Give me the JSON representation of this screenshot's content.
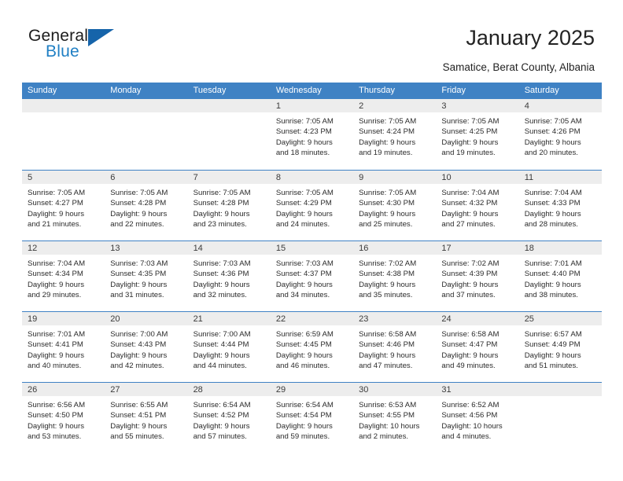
{
  "brand": {
    "name_part1": "General",
    "name_part2": "Blue",
    "logo_icon": "blue-triangle-logo"
  },
  "header": {
    "title": "January 2025",
    "subtitle": "Samatice, Berat County, Albania"
  },
  "colors": {
    "header_blue": "#3f82c4",
    "brand_blue": "#1f7fc4",
    "logo_blue": "#1664aa",
    "daynum_band": "#ededed",
    "text": "#2b2b2b"
  },
  "weekdays": [
    "Sunday",
    "Monday",
    "Tuesday",
    "Wednesday",
    "Thursday",
    "Friday",
    "Saturday"
  ],
  "weeks": [
    [
      {
        "day": "",
        "empty": true,
        "sunrise": "",
        "sunset": "",
        "daylight1": "",
        "daylight2": ""
      },
      {
        "day": "",
        "empty": true,
        "sunrise": "",
        "sunset": "",
        "daylight1": "",
        "daylight2": ""
      },
      {
        "day": "",
        "empty": true,
        "sunrise": "",
        "sunset": "",
        "daylight1": "",
        "daylight2": ""
      },
      {
        "day": "1",
        "empty": false,
        "sunrise": "Sunrise: 7:05 AM",
        "sunset": "Sunset: 4:23 PM",
        "daylight1": "Daylight: 9 hours",
        "daylight2": "and 18 minutes."
      },
      {
        "day": "2",
        "empty": false,
        "sunrise": "Sunrise: 7:05 AM",
        "sunset": "Sunset: 4:24 PM",
        "daylight1": "Daylight: 9 hours",
        "daylight2": "and 19 minutes."
      },
      {
        "day": "3",
        "empty": false,
        "sunrise": "Sunrise: 7:05 AM",
        "sunset": "Sunset: 4:25 PM",
        "daylight1": "Daylight: 9 hours",
        "daylight2": "and 19 minutes."
      },
      {
        "day": "4",
        "empty": false,
        "sunrise": "Sunrise: 7:05 AM",
        "sunset": "Sunset: 4:26 PM",
        "daylight1": "Daylight: 9 hours",
        "daylight2": "and 20 minutes."
      }
    ],
    [
      {
        "day": "5",
        "empty": false,
        "sunrise": "Sunrise: 7:05 AM",
        "sunset": "Sunset: 4:27 PM",
        "daylight1": "Daylight: 9 hours",
        "daylight2": "and 21 minutes."
      },
      {
        "day": "6",
        "empty": false,
        "sunrise": "Sunrise: 7:05 AM",
        "sunset": "Sunset: 4:28 PM",
        "daylight1": "Daylight: 9 hours",
        "daylight2": "and 22 minutes."
      },
      {
        "day": "7",
        "empty": false,
        "sunrise": "Sunrise: 7:05 AM",
        "sunset": "Sunset: 4:28 PM",
        "daylight1": "Daylight: 9 hours",
        "daylight2": "and 23 minutes."
      },
      {
        "day": "8",
        "empty": false,
        "sunrise": "Sunrise: 7:05 AM",
        "sunset": "Sunset: 4:29 PM",
        "daylight1": "Daylight: 9 hours",
        "daylight2": "and 24 minutes."
      },
      {
        "day": "9",
        "empty": false,
        "sunrise": "Sunrise: 7:05 AM",
        "sunset": "Sunset: 4:30 PM",
        "daylight1": "Daylight: 9 hours",
        "daylight2": "and 25 minutes."
      },
      {
        "day": "10",
        "empty": false,
        "sunrise": "Sunrise: 7:04 AM",
        "sunset": "Sunset: 4:32 PM",
        "daylight1": "Daylight: 9 hours",
        "daylight2": "and 27 minutes."
      },
      {
        "day": "11",
        "empty": false,
        "sunrise": "Sunrise: 7:04 AM",
        "sunset": "Sunset: 4:33 PM",
        "daylight1": "Daylight: 9 hours",
        "daylight2": "and 28 minutes."
      }
    ],
    [
      {
        "day": "12",
        "empty": false,
        "sunrise": "Sunrise: 7:04 AM",
        "sunset": "Sunset: 4:34 PM",
        "daylight1": "Daylight: 9 hours",
        "daylight2": "and 29 minutes."
      },
      {
        "day": "13",
        "empty": false,
        "sunrise": "Sunrise: 7:03 AM",
        "sunset": "Sunset: 4:35 PM",
        "daylight1": "Daylight: 9 hours",
        "daylight2": "and 31 minutes."
      },
      {
        "day": "14",
        "empty": false,
        "sunrise": "Sunrise: 7:03 AM",
        "sunset": "Sunset: 4:36 PM",
        "daylight1": "Daylight: 9 hours",
        "daylight2": "and 32 minutes."
      },
      {
        "day": "15",
        "empty": false,
        "sunrise": "Sunrise: 7:03 AM",
        "sunset": "Sunset: 4:37 PM",
        "daylight1": "Daylight: 9 hours",
        "daylight2": "and 34 minutes."
      },
      {
        "day": "16",
        "empty": false,
        "sunrise": "Sunrise: 7:02 AM",
        "sunset": "Sunset: 4:38 PM",
        "daylight1": "Daylight: 9 hours",
        "daylight2": "and 35 minutes."
      },
      {
        "day": "17",
        "empty": false,
        "sunrise": "Sunrise: 7:02 AM",
        "sunset": "Sunset: 4:39 PM",
        "daylight1": "Daylight: 9 hours",
        "daylight2": "and 37 minutes."
      },
      {
        "day": "18",
        "empty": false,
        "sunrise": "Sunrise: 7:01 AM",
        "sunset": "Sunset: 4:40 PM",
        "daylight1": "Daylight: 9 hours",
        "daylight2": "and 38 minutes."
      }
    ],
    [
      {
        "day": "19",
        "empty": false,
        "sunrise": "Sunrise: 7:01 AM",
        "sunset": "Sunset: 4:41 PM",
        "daylight1": "Daylight: 9 hours",
        "daylight2": "and 40 minutes."
      },
      {
        "day": "20",
        "empty": false,
        "sunrise": "Sunrise: 7:00 AM",
        "sunset": "Sunset: 4:43 PM",
        "daylight1": "Daylight: 9 hours",
        "daylight2": "and 42 minutes."
      },
      {
        "day": "21",
        "empty": false,
        "sunrise": "Sunrise: 7:00 AM",
        "sunset": "Sunset: 4:44 PM",
        "daylight1": "Daylight: 9 hours",
        "daylight2": "and 44 minutes."
      },
      {
        "day": "22",
        "empty": false,
        "sunrise": "Sunrise: 6:59 AM",
        "sunset": "Sunset: 4:45 PM",
        "daylight1": "Daylight: 9 hours",
        "daylight2": "and 46 minutes."
      },
      {
        "day": "23",
        "empty": false,
        "sunrise": "Sunrise: 6:58 AM",
        "sunset": "Sunset: 4:46 PM",
        "daylight1": "Daylight: 9 hours",
        "daylight2": "and 47 minutes."
      },
      {
        "day": "24",
        "empty": false,
        "sunrise": "Sunrise: 6:58 AM",
        "sunset": "Sunset: 4:47 PM",
        "daylight1": "Daylight: 9 hours",
        "daylight2": "and 49 minutes."
      },
      {
        "day": "25",
        "empty": false,
        "sunrise": "Sunrise: 6:57 AM",
        "sunset": "Sunset: 4:49 PM",
        "daylight1": "Daylight: 9 hours",
        "daylight2": "and 51 minutes."
      }
    ],
    [
      {
        "day": "26",
        "empty": false,
        "sunrise": "Sunrise: 6:56 AM",
        "sunset": "Sunset: 4:50 PM",
        "daylight1": "Daylight: 9 hours",
        "daylight2": "and 53 minutes."
      },
      {
        "day": "27",
        "empty": false,
        "sunrise": "Sunrise: 6:55 AM",
        "sunset": "Sunset: 4:51 PM",
        "daylight1": "Daylight: 9 hours",
        "daylight2": "and 55 minutes."
      },
      {
        "day": "28",
        "empty": false,
        "sunrise": "Sunrise: 6:54 AM",
        "sunset": "Sunset: 4:52 PM",
        "daylight1": "Daylight: 9 hours",
        "daylight2": "and 57 minutes."
      },
      {
        "day": "29",
        "empty": false,
        "sunrise": "Sunrise: 6:54 AM",
        "sunset": "Sunset: 4:54 PM",
        "daylight1": "Daylight: 9 hours",
        "daylight2": "and 59 minutes."
      },
      {
        "day": "30",
        "empty": false,
        "sunrise": "Sunrise: 6:53 AM",
        "sunset": "Sunset: 4:55 PM",
        "daylight1": "Daylight: 10 hours",
        "daylight2": "and 2 minutes."
      },
      {
        "day": "31",
        "empty": false,
        "sunrise": "Sunrise: 6:52 AM",
        "sunset": "Sunset: 4:56 PM",
        "daylight1": "Daylight: 10 hours",
        "daylight2": "and 4 minutes."
      },
      {
        "day": "",
        "empty": true,
        "sunrise": "",
        "sunset": "",
        "daylight1": "",
        "daylight2": ""
      }
    ]
  ]
}
